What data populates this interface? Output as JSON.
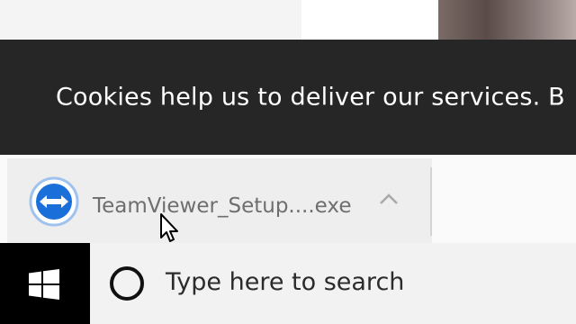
{
  "cookie_banner": {
    "message": "Cookies help us to deliver our services. B"
  },
  "download_bar": {
    "items": [
      {
        "filename": "TeamViewer_Setup....exe",
        "icon": "teamviewer-icon"
      }
    ],
    "expand_icon": "chevron-up-icon"
  },
  "taskbar": {
    "start_icon": "windows-logo-icon",
    "search": {
      "icon": "cortana-icon",
      "placeholder": "Type here to search"
    }
  },
  "colors": {
    "banner_bg": "#262626",
    "taskbar_bg": "#000000",
    "search_bg": "#f2f2f2",
    "teamviewer_blue": "#1a6fd8"
  }
}
